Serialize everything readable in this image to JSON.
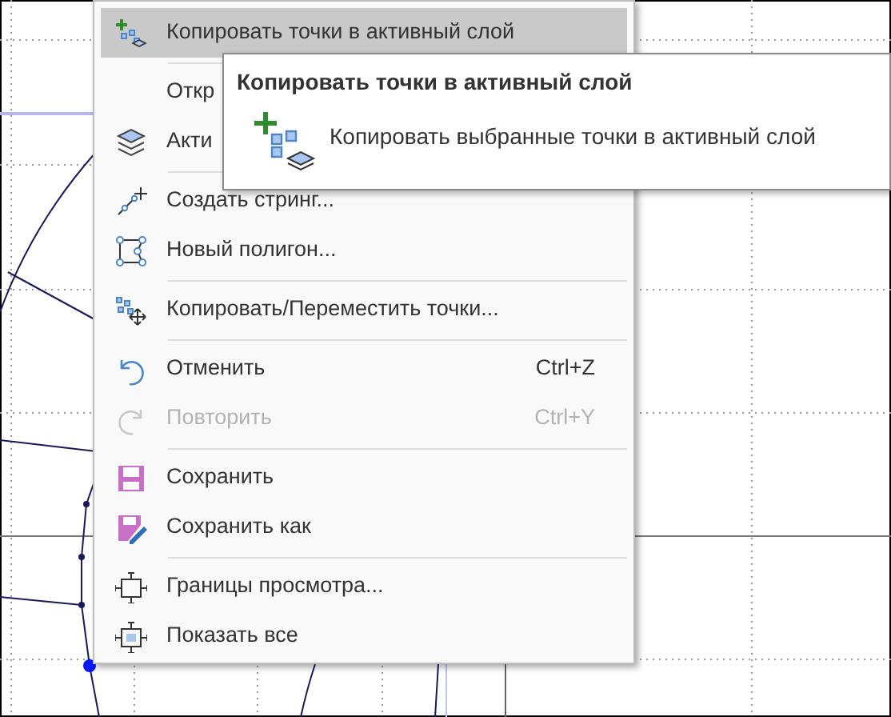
{
  "menu": {
    "groups": [
      [
        {
          "label": "Копировать точки в активный слой",
          "highlighted": true,
          "disabled": false
        }
      ],
      [
        {
          "label": "Откр",
          "highlighted": false,
          "disabled": false
        },
        {
          "label": "Акти",
          "highlighted": false,
          "disabled": false
        }
      ],
      [
        {
          "label": "Создать стринг...",
          "highlighted": false,
          "disabled": false
        },
        {
          "label": "Новый полигон...",
          "highlighted": false,
          "disabled": false
        }
      ],
      [
        {
          "label": "Копировать/Переместить точки...",
          "highlighted": false,
          "disabled": false
        }
      ],
      [
        {
          "label": "Отменить",
          "shortcut": "Ctrl+Z",
          "highlighted": false,
          "disabled": false
        },
        {
          "label": "Повторить",
          "shortcut": "Ctrl+Y",
          "highlighted": false,
          "disabled": true
        }
      ],
      [
        {
          "label": "Сохранить",
          "highlighted": false,
          "disabled": false
        },
        {
          "label": "Сохранить как",
          "highlighted": false,
          "disabled": false
        }
      ],
      [
        {
          "label": "Границы просмотра...",
          "highlighted": false,
          "disabled": false
        },
        {
          "label": "Показать все",
          "highlighted": false,
          "disabled": false
        }
      ]
    ]
  },
  "tooltip": {
    "title": "Копировать точки в активный слой",
    "text": "Копировать выбранные точки в активный слой"
  }
}
